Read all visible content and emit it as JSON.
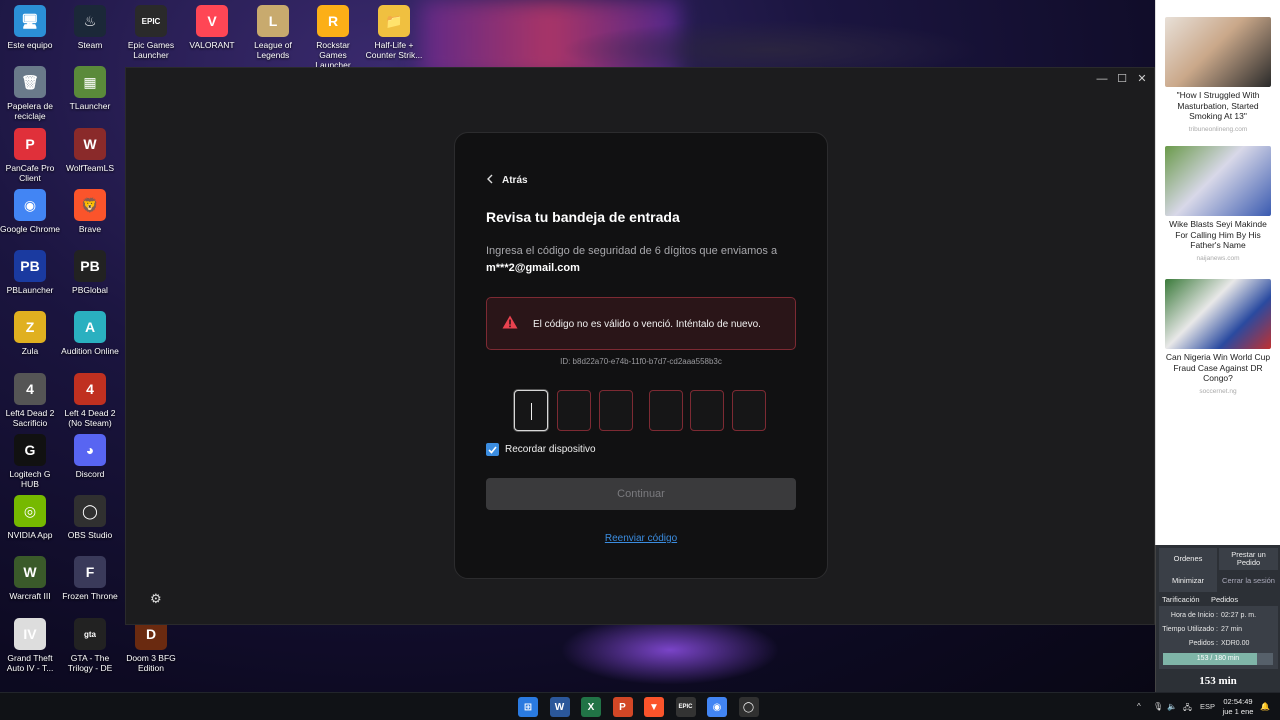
{
  "desktop": {
    "icons": [
      {
        "label": "Este equipo",
        "icon": "monitor-icon",
        "color": "#2b8fd6",
        "glyph": "🖥"
      },
      {
        "label": "Steam",
        "icon": "steam-icon",
        "color": "#1b2838",
        "glyph": "♨"
      },
      {
        "label": "Epic Games Launcher",
        "icon": "epic-games-icon",
        "color": "#2a2a2a",
        "glyph": "EPIC"
      },
      {
        "label": "VALORANT",
        "icon": "valorant-icon",
        "color": "#ff4655",
        "glyph": "V"
      },
      {
        "label": "League of Legends",
        "icon": "league-icon",
        "color": "#c8aa6e",
        "glyph": "L"
      },
      {
        "label": "Rockstar Games Launcher",
        "icon": "rockstar-icon",
        "color": "#fcaf17",
        "glyph": "R"
      },
      {
        "label": "Half-Life + Counter Strik...",
        "icon": "folder-icon",
        "color": "#f0c040",
        "glyph": "📁"
      },
      {
        "label": "Papelera de reciclaje",
        "icon": "recycle-bin-icon",
        "color": "#6a7a8a",
        "glyph": "🗑"
      },
      {
        "label": "TLauncher",
        "icon": "tlauncher-icon",
        "color": "#5a8a3a",
        "glyph": "▦"
      },
      {
        "label": "PanCafe Pro Client",
        "icon": "pancafe-icon",
        "color": "#e0303a",
        "glyph": "P"
      },
      {
        "label": "WolfTeamLS",
        "icon": "wolfteam-icon",
        "color": "#8a2a2a",
        "glyph": "W"
      },
      {
        "label": "Google Chrome",
        "icon": "chrome-icon",
        "color": "#4285f4",
        "glyph": "◉"
      },
      {
        "label": "Brave",
        "icon": "brave-icon",
        "color": "#fb542b",
        "glyph": "🦁"
      },
      {
        "label": "PBLauncher",
        "icon": "pblauncher-icon",
        "color": "#1a3aa0",
        "glyph": "PB"
      },
      {
        "label": "PBGlobal",
        "icon": "pbglobal-icon",
        "color": "#222222",
        "glyph": "PB"
      },
      {
        "label": "Zula",
        "icon": "zula-icon",
        "color": "#e0b020",
        "glyph": "Z"
      },
      {
        "label": "Audition Online",
        "icon": "audition-icon",
        "color": "#2ab0c0",
        "glyph": "A"
      },
      {
        "label": "Left4 Dead 2 Sacrificio",
        "icon": "left4dead-icon",
        "color": "#555555",
        "glyph": "4"
      },
      {
        "label": "Left 4 Dead 2 (No Steam)",
        "icon": "left4dead-nosteam-icon",
        "color": "#c03020",
        "glyph": "4"
      },
      {
        "label": "Logitech G HUB",
        "icon": "logitech-icon",
        "color": "#111111",
        "glyph": "G"
      },
      {
        "label": "Discord",
        "icon": "discord-icon",
        "color": "#5865f2",
        "glyph": "◕"
      },
      {
        "label": "NVIDIA App",
        "icon": "nvidia-icon",
        "color": "#76b900",
        "glyph": "◎"
      },
      {
        "label": "OBS Studio",
        "icon": "obs-icon",
        "color": "#303030",
        "glyph": "◯"
      },
      {
        "label": "Warcraft III",
        "icon": "warcraft-icon",
        "color": "#3a5a2a",
        "glyph": "W"
      },
      {
        "label": "Frozen Throne",
        "icon": "frozen-throne-icon",
        "color": "#3a3a5a",
        "glyph": "F"
      },
      {
        "label": "Grand Theft Auto IV - T...",
        "icon": "gta4-icon",
        "color": "#dddddd",
        "glyph": "IV"
      },
      {
        "label": "GTA - The Trilogy - DE",
        "icon": "gta-trilogy-icon",
        "color": "#222222",
        "glyph": "gta"
      },
      {
        "label": "Doom 3 BFG Edition",
        "icon": "doom-icon",
        "color": "#6a2a10",
        "glyph": "D"
      }
    ]
  },
  "window": {
    "controls": {
      "minimize": "—",
      "maximize": "☐",
      "close": "✕"
    }
  },
  "auth": {
    "back_label": "Atrás",
    "title": "Revisa tu bandeja de entrada",
    "instructions_prefix": "Ingresa el código de seguridad de 6 dígitos que enviamos a",
    "email": "m***2@gmail.com",
    "error_message": "El código no es válido o venció. Inténtalo de nuevo.",
    "session_id": "ID: b8d22a70-e74b-11f0-b7d7-cd2aaa558b3c",
    "remember_label": "Recordar dispositivo",
    "remember_checked": true,
    "continue_label": "Continuar",
    "resend_label": "Reenviar código",
    "accent_color": "#3b8de0",
    "error_color": "#7d2a33"
  },
  "ads": [
    {
      "title": "\"How I Struggled With Masturbation, Started Smoking At 13\"",
      "source": "tribuneonlineng.com"
    },
    {
      "title": "Wike Blasts Seyi Makinde For Calling Him By His Father's Name",
      "source": "naijanews.com"
    },
    {
      "title": "Can Nigeria Win World Cup Fraud Case Against DR Congo?",
      "source": "soccernet.ng"
    }
  ],
  "cafe_timer": {
    "orders_label": "Ordenes",
    "lend_order_label": "Prestar un Pedido",
    "minimize_label": "Minimizar",
    "logout_label": "Cerrar la sesión",
    "tab_billing": "Tarificación",
    "tab_orders": "Pedidos",
    "start_time_label": "Hora de Inicio :",
    "start_time_value": "02:27 p. m.",
    "time_used_label": "Tiempo Utilizado :",
    "time_used_value": "27 min",
    "orders_amount_label": "Pedidos :",
    "orders_amount_value": "XDR0.00",
    "progress_label": "153 / 180 min",
    "progress_fraction": 0.85,
    "remaining_label": "153 min"
  },
  "taskbar": {
    "apps": [
      {
        "icon": "windows-start-icon",
        "color": "#2a7ae0",
        "glyph": "⊞"
      },
      {
        "icon": "word-icon",
        "color": "#2b579a",
        "glyph": "W"
      },
      {
        "icon": "excel-icon",
        "color": "#217346",
        "glyph": "X"
      },
      {
        "icon": "powerpoint-icon",
        "color": "#d24726",
        "glyph": "P"
      },
      {
        "icon": "brave-taskbar-icon",
        "color": "#fb542b",
        "glyph": "▼"
      },
      {
        "icon": "epic-taskbar-icon",
        "color": "#333333",
        "glyph": "EPIC"
      },
      {
        "icon": "chrome-taskbar-icon",
        "color": "#4285f4",
        "glyph": "◉"
      },
      {
        "icon": "obs-taskbar-icon",
        "color": "#303030",
        "glyph": "◯"
      }
    ],
    "tray_chevron": "^",
    "language": "ESP",
    "time": "02:54:49",
    "date": "jue 1 ene"
  }
}
